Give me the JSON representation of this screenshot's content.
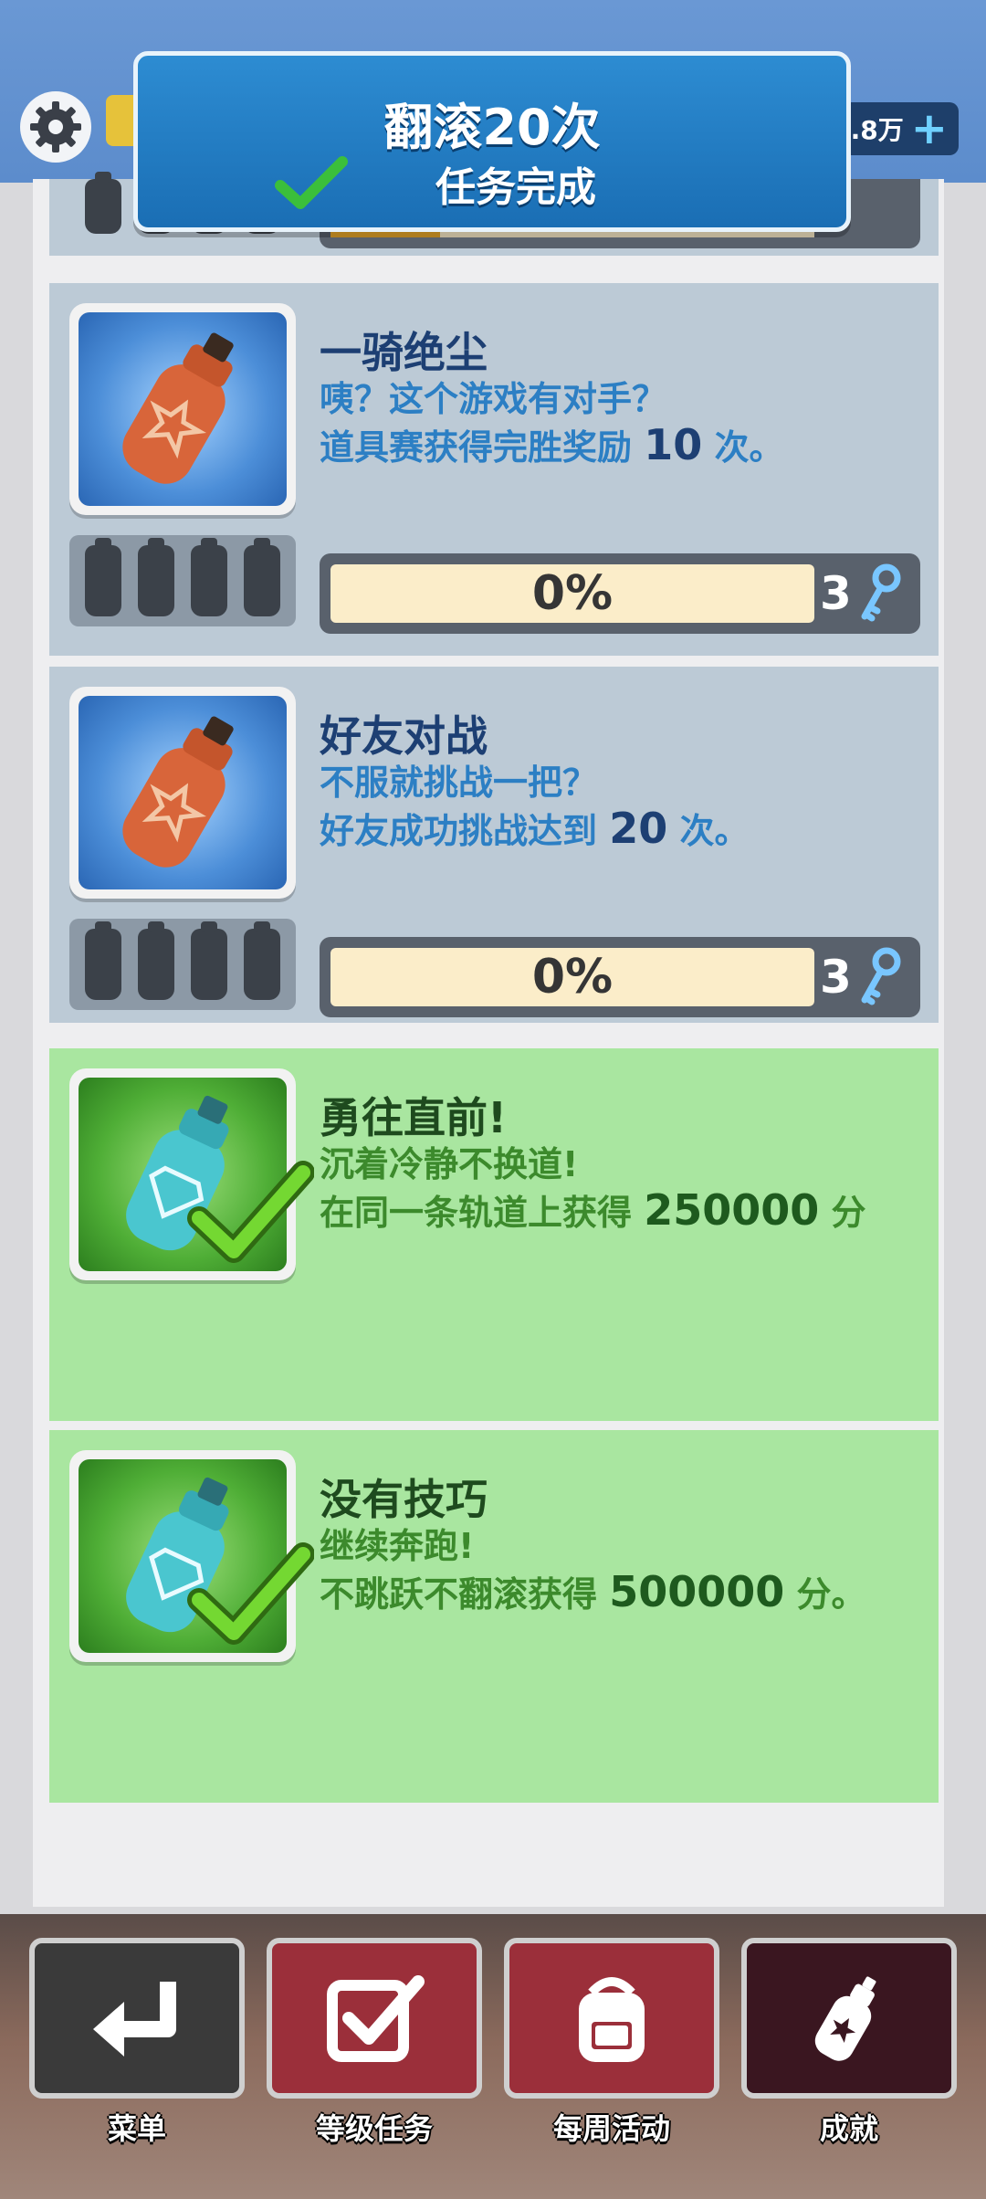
{
  "header": {
    "currency_value": ".8万",
    "plus_label": "+"
  },
  "banner": {
    "title": "翻滚20次",
    "subtitle": "任务完成"
  },
  "missions": [
    {
      "title": "一骑绝尘",
      "line1": "咦？这个游戏有对手？",
      "line2_prefix": "道具赛获得完胜奖励 ",
      "line2_num": "10",
      "line2_suffix": " 次。",
      "progress": "0%",
      "reward": "3",
      "status": "in-progress"
    },
    {
      "title": "好友对战",
      "line1": "不服就挑战一把？",
      "line2_prefix": "好友成功挑战达到 ",
      "line2_num": "20",
      "line2_suffix": " 次。",
      "progress": "0%",
      "reward": "3",
      "status": "in-progress"
    },
    {
      "title": "勇往直前!",
      "line1": "沉着冷静不换道!",
      "line2_prefix": "在同一条轨道上获得 ",
      "line2_num": "250000",
      "line2_suffix": " 分",
      "status": "completed"
    },
    {
      "title": "没有技巧",
      "line1": "继续奔跑!",
      "line2_prefix": "不跳跃不翻滚获得 ",
      "line2_num": "500000",
      "line2_suffix": " 分。",
      "status": "completed"
    }
  ],
  "nav": [
    {
      "label": "菜单",
      "icon": "return-arrow-icon",
      "color": "#3a3a3a"
    },
    {
      "label": "等级任务",
      "icon": "checkbox-icon",
      "color": "#9b2f3a"
    },
    {
      "label": "每周活动",
      "icon": "backpack-icon",
      "color": "#9b2f3a"
    },
    {
      "label": "成就",
      "icon": "spray-can-icon",
      "color": "#3a1620"
    }
  ],
  "colors": {
    "header_blue": "#5c8ccc",
    "banner_blue": "#1a6eb4",
    "card_grey": "#bccad6",
    "card_green": "#a9e6a0",
    "progress_fill": "#fbedc9"
  }
}
